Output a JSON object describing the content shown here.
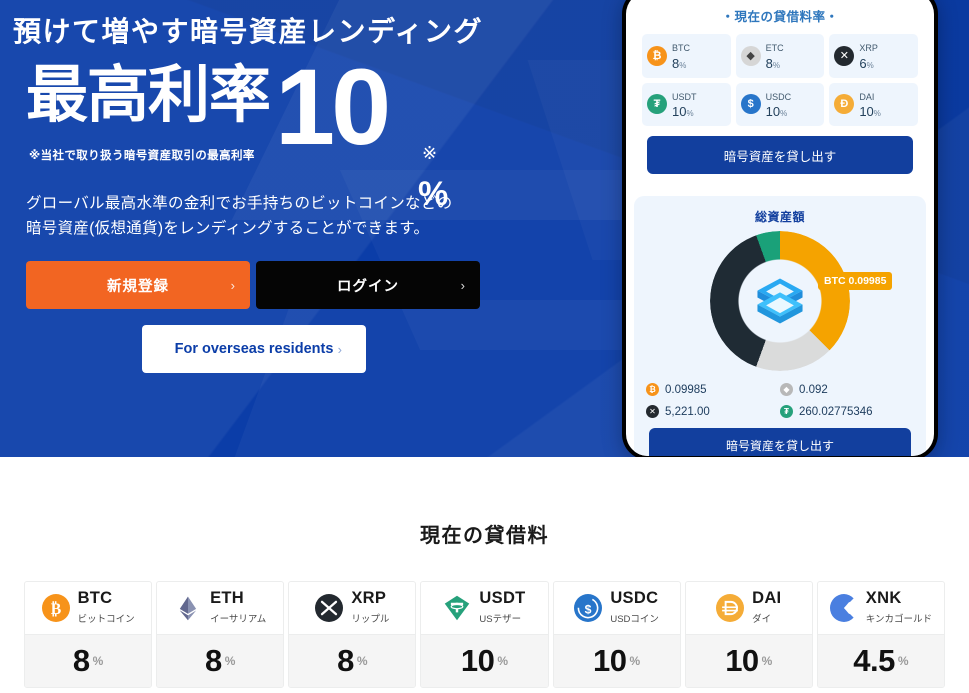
{
  "hero": {
    "title": "預けて増やす暗号資産レンディング",
    "rate_kanji": "最高利率",
    "rate_number": "10",
    "rate_asterisk": "※",
    "rate_percent": "%",
    "rate_note": "※当社で取り扱う暗号資産取引の最高利率",
    "description_line1": "グローバル最高水準の金利でお手持ちのビットコインなどの",
    "description_line2": "暗号資産(仮想通貨)をレンディングすることができます。",
    "buttons": {
      "signup": "新規登録",
      "login": "ログイン",
      "overseas": "For overseas residents",
      "chevron": "›"
    }
  },
  "phone": {
    "rate_card_heading": "・現在の貸借料率・",
    "rates": [
      {
        "symbol": "BTC",
        "value": "8",
        "unit": "%",
        "color": "#f7931a",
        "glyph": "₿"
      },
      {
        "symbol": "ETC",
        "value": "8",
        "unit": "%",
        "color": "#d6d6d6",
        "glyph": "◆"
      },
      {
        "symbol": "XRP",
        "value": "6",
        "unit": "%",
        "color": "#23292f",
        "glyph": "✕"
      },
      {
        "symbol": "USDT",
        "value": "10",
        "unit": "%",
        "color": "#26a17b",
        "glyph": "₮"
      },
      {
        "symbol": "USDC",
        "value": "10",
        "unit": "%",
        "color": "#2775ca",
        "glyph": "$"
      },
      {
        "symbol": "DAI",
        "value": "10",
        "unit": "%",
        "color": "#f5ac37",
        "glyph": "Ð"
      }
    ],
    "lend_button": "暗号資産を貸し出す",
    "asset_title": "総資産額",
    "donut_tooltip": "BTC 0.09985",
    "legend": [
      {
        "value": "0.09985",
        "color": "#f7931a",
        "glyph": "₿"
      },
      {
        "value": "0.092",
        "color": "#b8b8b8",
        "glyph": "◆"
      },
      {
        "value": "5,221.00",
        "color": "#23292f",
        "glyph": "✕"
      },
      {
        "value": "260.02775346",
        "color": "#26a17b",
        "glyph": "₮"
      }
    ],
    "bottom_button": "暗号資産を貸し出す"
  },
  "rates_section": {
    "title": "現在の貸借料",
    "cards": [
      {
        "symbol": "BTC",
        "jp": "ビットコイン",
        "value": "8",
        "unit": "%",
        "icon": "btc-icon"
      },
      {
        "symbol": "ETH",
        "jp": "イーサリアム",
        "value": "8",
        "unit": "%",
        "icon": "eth-icon"
      },
      {
        "symbol": "XRP",
        "jp": "リップル",
        "value": "8",
        "unit": "%",
        "icon": "xrp-icon"
      },
      {
        "symbol": "USDT",
        "jp": "USテザー",
        "value": "10",
        "unit": "%",
        "icon": "usdt-icon"
      },
      {
        "symbol": "USDC",
        "jp": "USDコイン",
        "value": "10",
        "unit": "%",
        "icon": "usdc-icon"
      },
      {
        "symbol": "DAI",
        "jp": "ダイ",
        "value": "10",
        "unit": "%",
        "icon": "dai-icon"
      },
      {
        "symbol": "XNK",
        "jp": "キンカゴールド",
        "value": "4.5",
        "unit": "%",
        "icon": "xnk-icon"
      }
    ]
  },
  "colors": {
    "hero_blue": "#0b3da8",
    "orange": "#f26522",
    "black": "#050505",
    "accent_blue": "#123f9e"
  }
}
